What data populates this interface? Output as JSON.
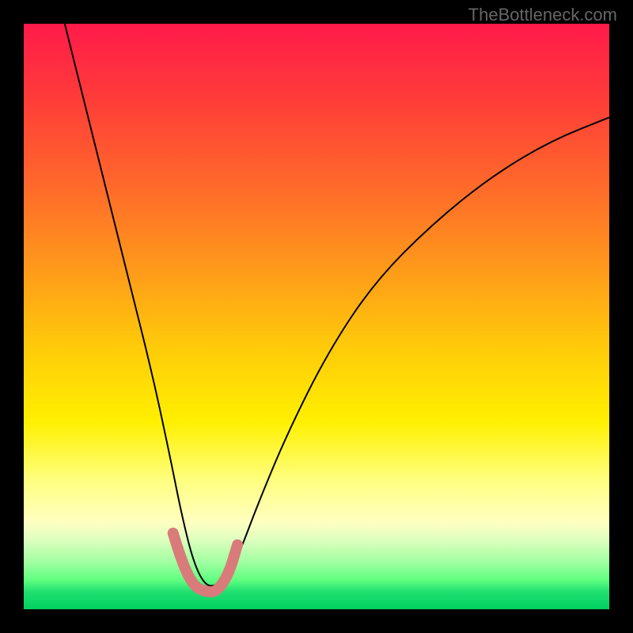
{
  "watermark": "TheBottleneck.com",
  "chart_data": {
    "type": "line",
    "title": "",
    "xlabel": "",
    "ylabel": "",
    "xlim": [
      0,
      100
    ],
    "ylim": [
      0,
      100
    ],
    "description": "Bottleneck curve over rainbow gradient (red=high bottleneck, green=low). V-shaped black curve reaching minimum near x≈30, with salmon highlight marking the optimal flat region at the valley bottom.",
    "series": [
      {
        "name": "bottleneck-curve",
        "color": "#000000",
        "x": [
          7,
          10,
          14,
          18,
          22,
          25,
          27,
          29,
          31,
          33,
          35,
          37,
          40,
          45,
          52,
          60,
          70,
          80,
          90,
          100
        ],
        "y": [
          100,
          88,
          72,
          56,
          40,
          26,
          16,
          8,
          4,
          4,
          6,
          10,
          18,
          30,
          44,
          56,
          66,
          74,
          80,
          84
        ]
      },
      {
        "name": "optimal-band",
        "color": "#d97b7b",
        "x": [
          25.5,
          27,
          29,
          31,
          33,
          35,
          36.5
        ],
        "y": [
          13,
          8,
          4,
          3,
          3,
          6,
          11
        ]
      }
    ]
  }
}
